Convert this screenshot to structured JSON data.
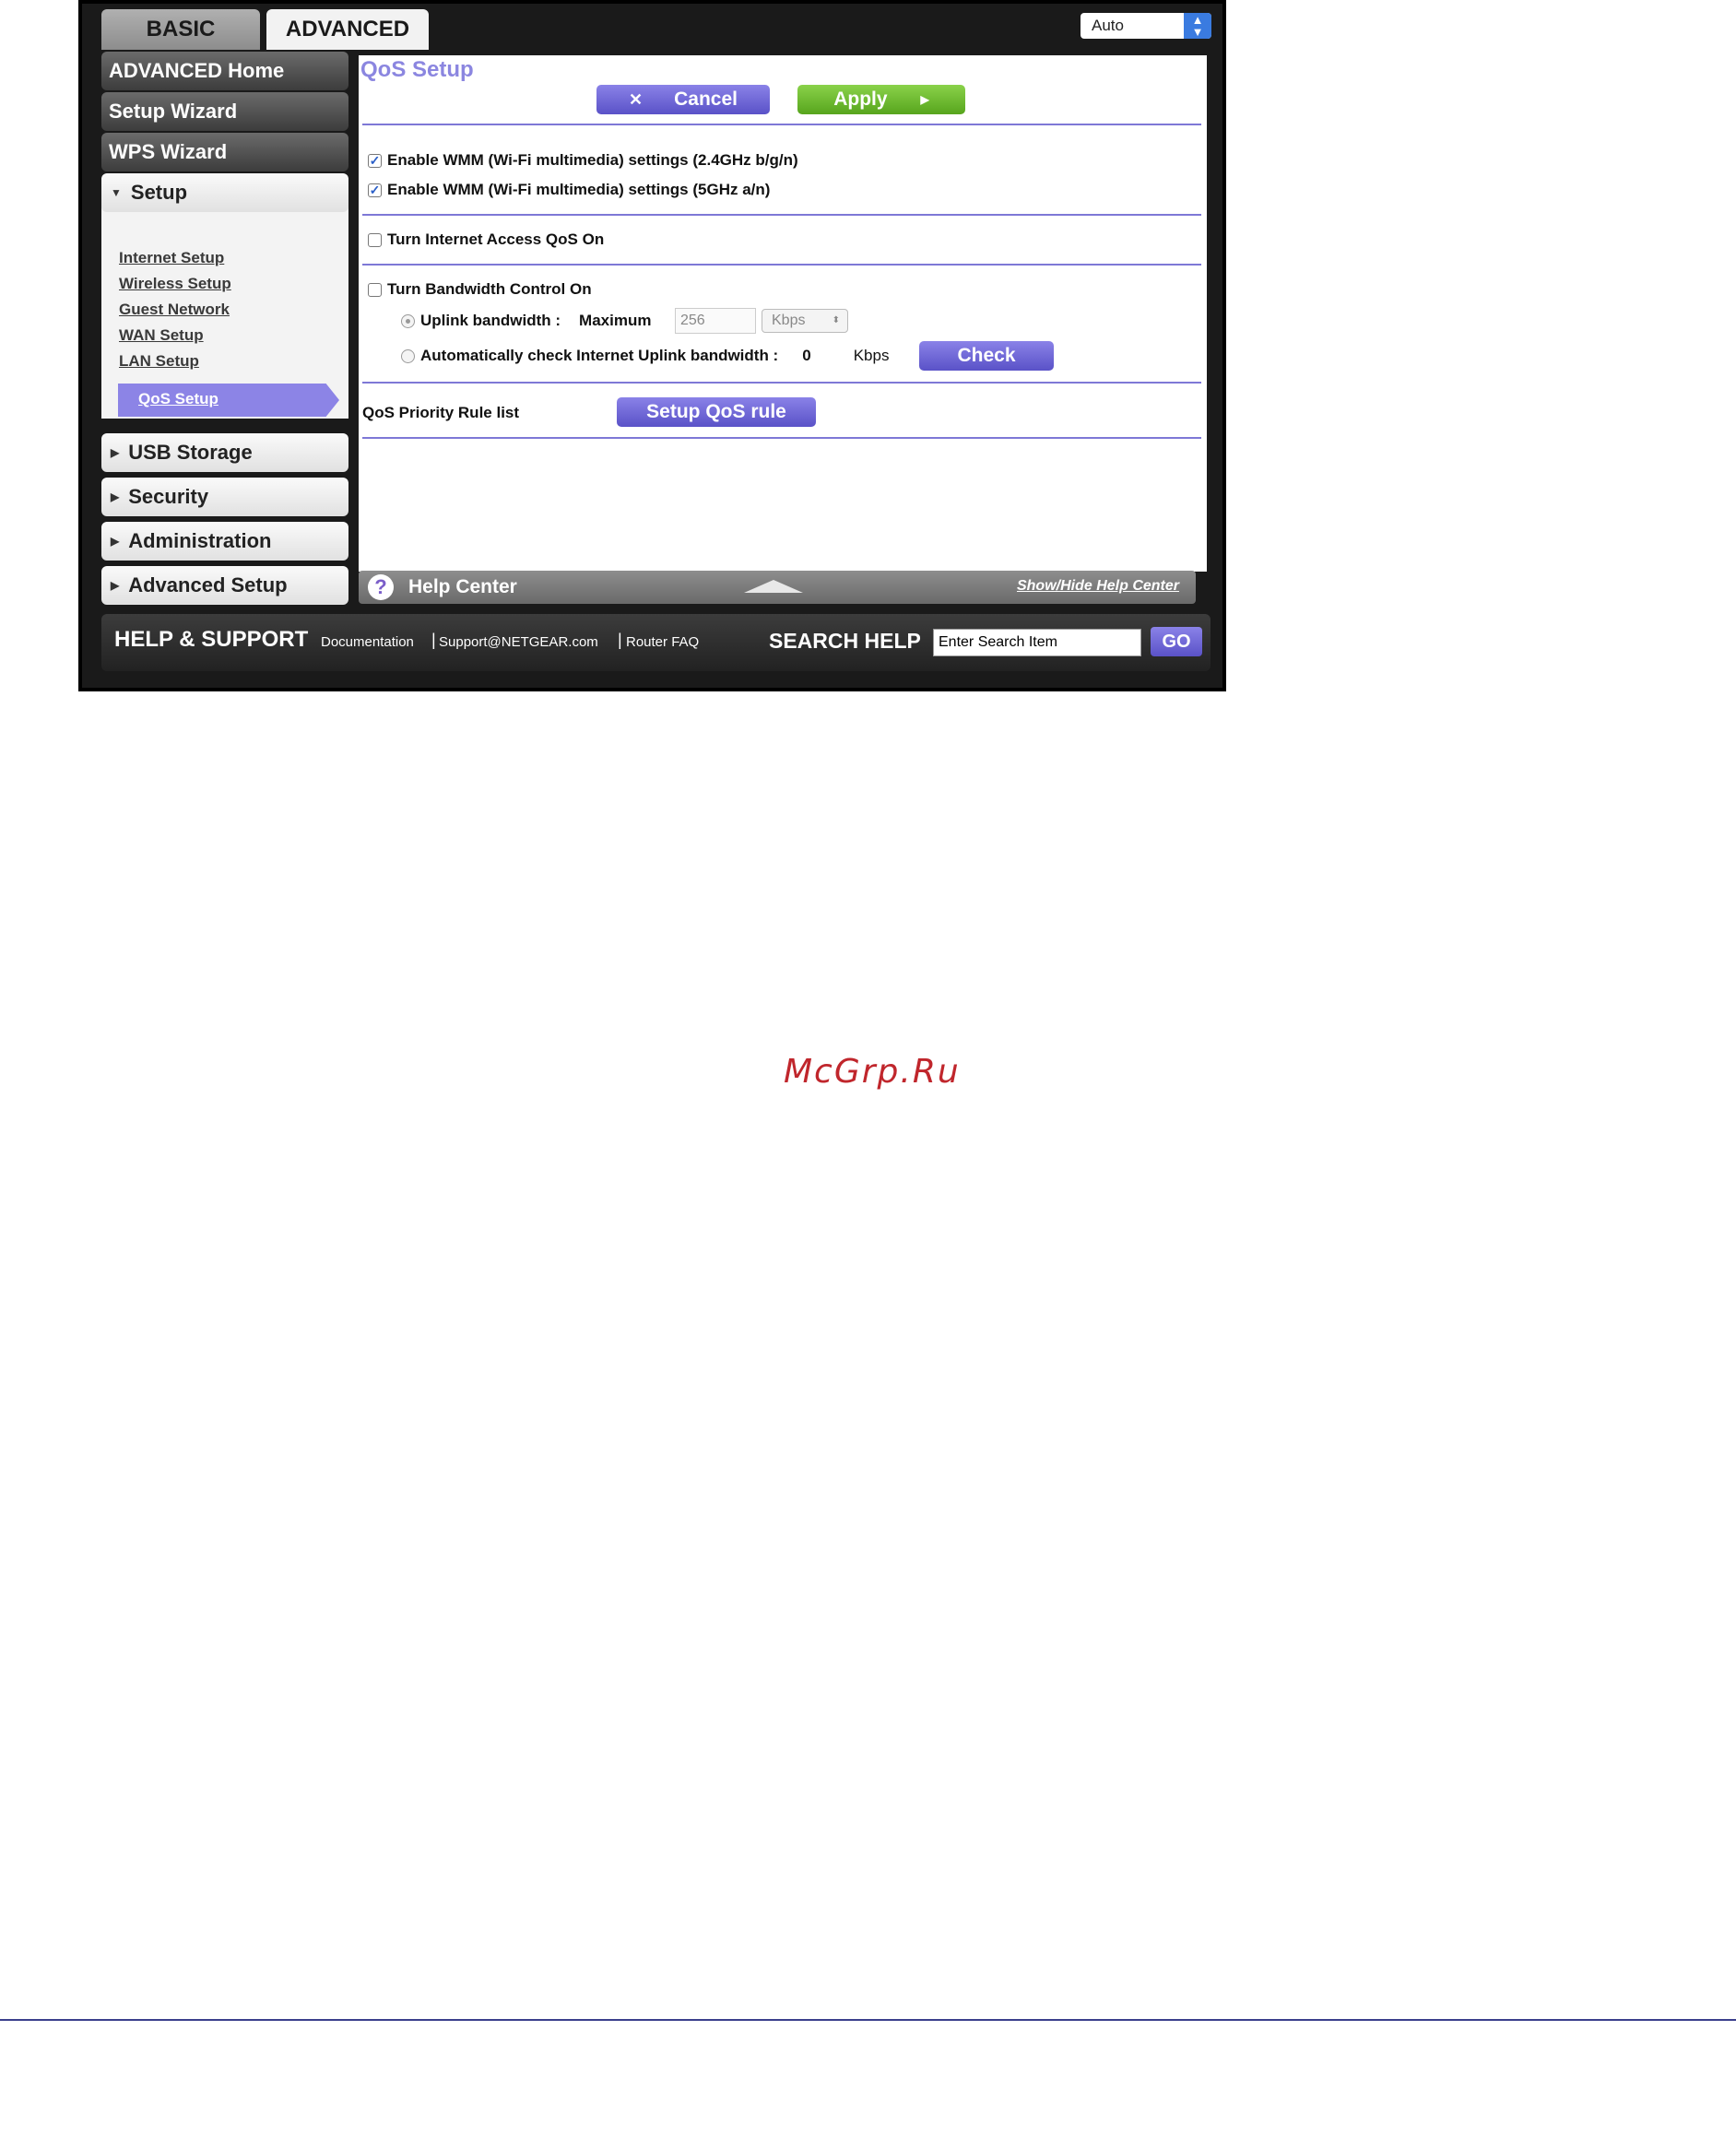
{
  "tabs": {
    "basic": "BASIC",
    "advanced": "ADVANCED"
  },
  "language": {
    "selected": "Auto"
  },
  "sidebar": {
    "advanced_home": "ADVANCED Home",
    "setup_wizard": "Setup Wizard",
    "wps_wizard": "WPS Wizard",
    "setup": "Setup",
    "setup_items": [
      "Internet Setup",
      "Wireless Setup",
      "Guest Network",
      "WAN Setup",
      "LAN Setup",
      "QoS Setup"
    ],
    "usb_storage": "USB Storage",
    "security": "Security",
    "administration": "Administration",
    "advanced_setup": "Advanced Setup"
  },
  "content": {
    "title": "QoS Setup",
    "cancel_label": "Cancel",
    "apply_label": "Apply",
    "wmm_24": "Enable WMM (Wi-Fi multimedia) settings (2.4GHz b/g/n)",
    "wmm_5": "Enable WMM (Wi-Fi multimedia) settings (5GHz a/n)",
    "internet_qos": "Turn Internet Access QoS On",
    "bandwidth_control": "Turn Bandwidth Control On",
    "uplink_label": "Uplink bandwidth :",
    "maximum_label": "Maximum",
    "maximum_value": "256",
    "unit_select": "Kbps",
    "auto_check_label": "Automatically check Internet Uplink bandwidth :",
    "auto_value": "0",
    "auto_unit": "Kbps",
    "check_label": "Check",
    "priority_list_label": "QoS Priority Rule list",
    "setup_rule_label": "Setup QoS rule"
  },
  "help": {
    "title": "Help Center",
    "toggle": "Show/Hide Help Center"
  },
  "footer": {
    "title": "HELP & SUPPORT",
    "links": [
      "Documentation",
      "Support@NETGEAR.com",
      "Router FAQ"
    ],
    "search_title": "SEARCH HELP",
    "search_value": "Enter Search Item",
    "go_label": "GO"
  },
  "watermark": "McGrp.Ru",
  "colors": {
    "accent": "#8b86e0",
    "apply": "#6fbf2e",
    "dark": "#1a1a1a"
  }
}
